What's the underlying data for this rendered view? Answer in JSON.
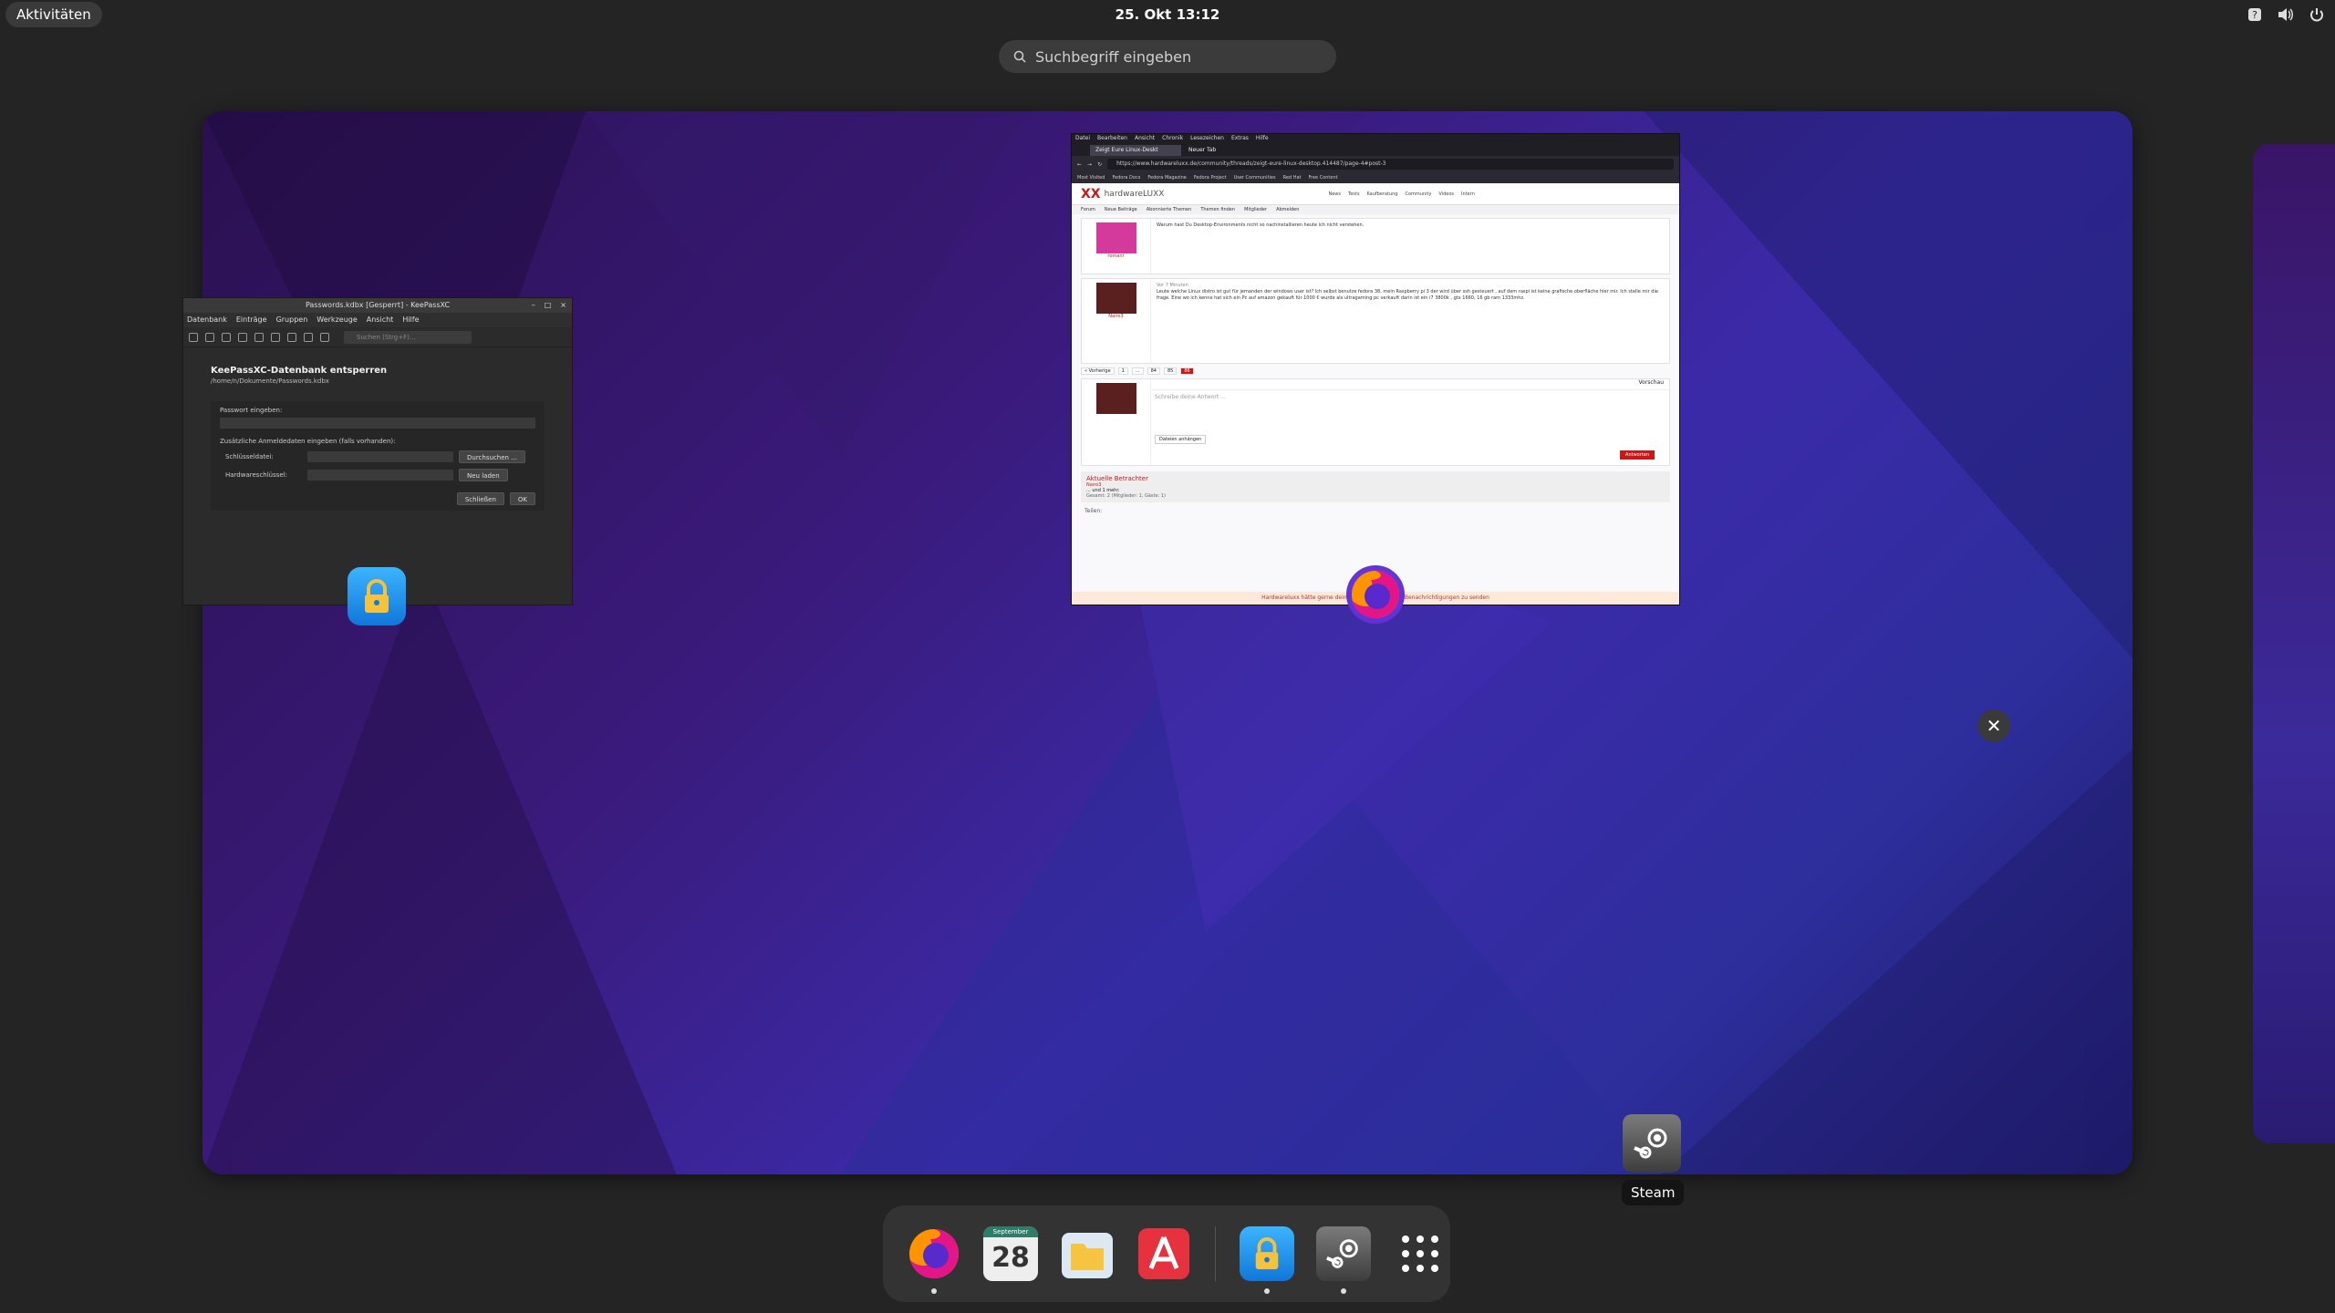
{
  "topbar": {
    "activities": "Aktivitäten",
    "clock": "25. Okt  13:12"
  },
  "search": {
    "placeholder": "Suchbegriff eingeben"
  },
  "keepass": {
    "title": "Passwords.kdbx [Gesperrt] - KeePassXC",
    "menu": [
      "Datenbank",
      "Einträge",
      "Gruppen",
      "Werkzeuge",
      "Ansicht",
      "Hilfe"
    ],
    "search_placeholder": "Suchen (Strg+F)...",
    "heading": "KeePassXC-Datenbank entsperren",
    "path": "/home/n/Dokumente/Passwords.kdbx",
    "password_label": "Passwort eingeben:",
    "extra_label": "Zusätzliche Anmeldedaten eingeben (falls vorhanden):",
    "keyfile_label": "Schlüsseldatei:",
    "browse": "Durchsuchen ...",
    "hwkey_label": "Hardwareschlüssel:",
    "reload": "Neu laden",
    "close": "Schließen",
    "ok": "OK"
  },
  "firefox": {
    "menu": [
      "Datei",
      "Bearbeiten",
      "Ansicht",
      "Chronik",
      "Lesezeichen",
      "Extras",
      "Hilfe"
    ],
    "tab1": "Zeigt Eure Linux-Deskt",
    "tab2": "Neuer Tab",
    "url": "https://www.hardwareluxx.de/community/threads/zeigt-eure-linux-desktop.414487/page-4#post-3",
    "bookmarks": [
      "Most Visited",
      "Fedora Docs",
      "Fedora Magazine",
      "Fedora Project",
      "User Communities",
      "Red Hat",
      "Free Content"
    ],
    "site_logo": "XX",
    "site_name": "hardwareLUXX",
    "site_nav": [
      "News",
      "Tests",
      "Kaufberatung",
      "Community",
      "Videos",
      "Intern"
    ],
    "subnav": [
      "Forum",
      "Neue Beiträge",
      "Abonnierte Themen",
      "Themen finden",
      "Mitglieder",
      "Abmelden"
    ],
    "post1_author": "romanr",
    "post2_author": "Nairo3",
    "post2_date": "Vor 7 Minuten",
    "post2_text": "Leute welche Linux distro ist gut für jemanden der windows user ist? Ich selbst benutze fedora 38, mein Raspberry pi 3 der wird über ssh gesteuert , auf dem raspi ist keine grafische oberfläche hier mir. Ich stelle mir die frage. Eine wo ich kenne hat sich ein Pc auf amazon gekauft für 1000 € wurde als ultragaming pc verkauft darin ist ein i7 3800k , gtx 1660, 16 gb ram 1333mhz.",
    "post1_text": "Warum hast Du Desktop-Environments nicht so nachinstallieren heute ich nicht verstehen.",
    "editor_placeholder": "Schreibe deine Antwort ...",
    "attach": "Dateien anhängen",
    "reply": "Antworten",
    "preview": "Vorschau",
    "viewers_heading": "Aktuelle Betrachter",
    "viewers_name": "Nairo3",
    "viewers_more": "... und 1 mehr.",
    "viewers_summary": "Gesamt: 2 (Mitglieder: 1, Gäste: 1)",
    "share_label": "Teilen:",
    "notice": "Hardwareluxx hätte gerne deine Erlaubnis, dir Push-Benachrichtigungen zu senden",
    "pager": [
      "« Vorherige",
      "1",
      "...",
      "84",
      "85",
      "86"
    ]
  },
  "tooltip": {
    "steam": "Steam"
  },
  "dash": {
    "calendar_month": "September",
    "calendar_day": "28"
  },
  "colors": {
    "accent": "#c81919",
    "panel": "#242424",
    "dash": "#333333"
  }
}
